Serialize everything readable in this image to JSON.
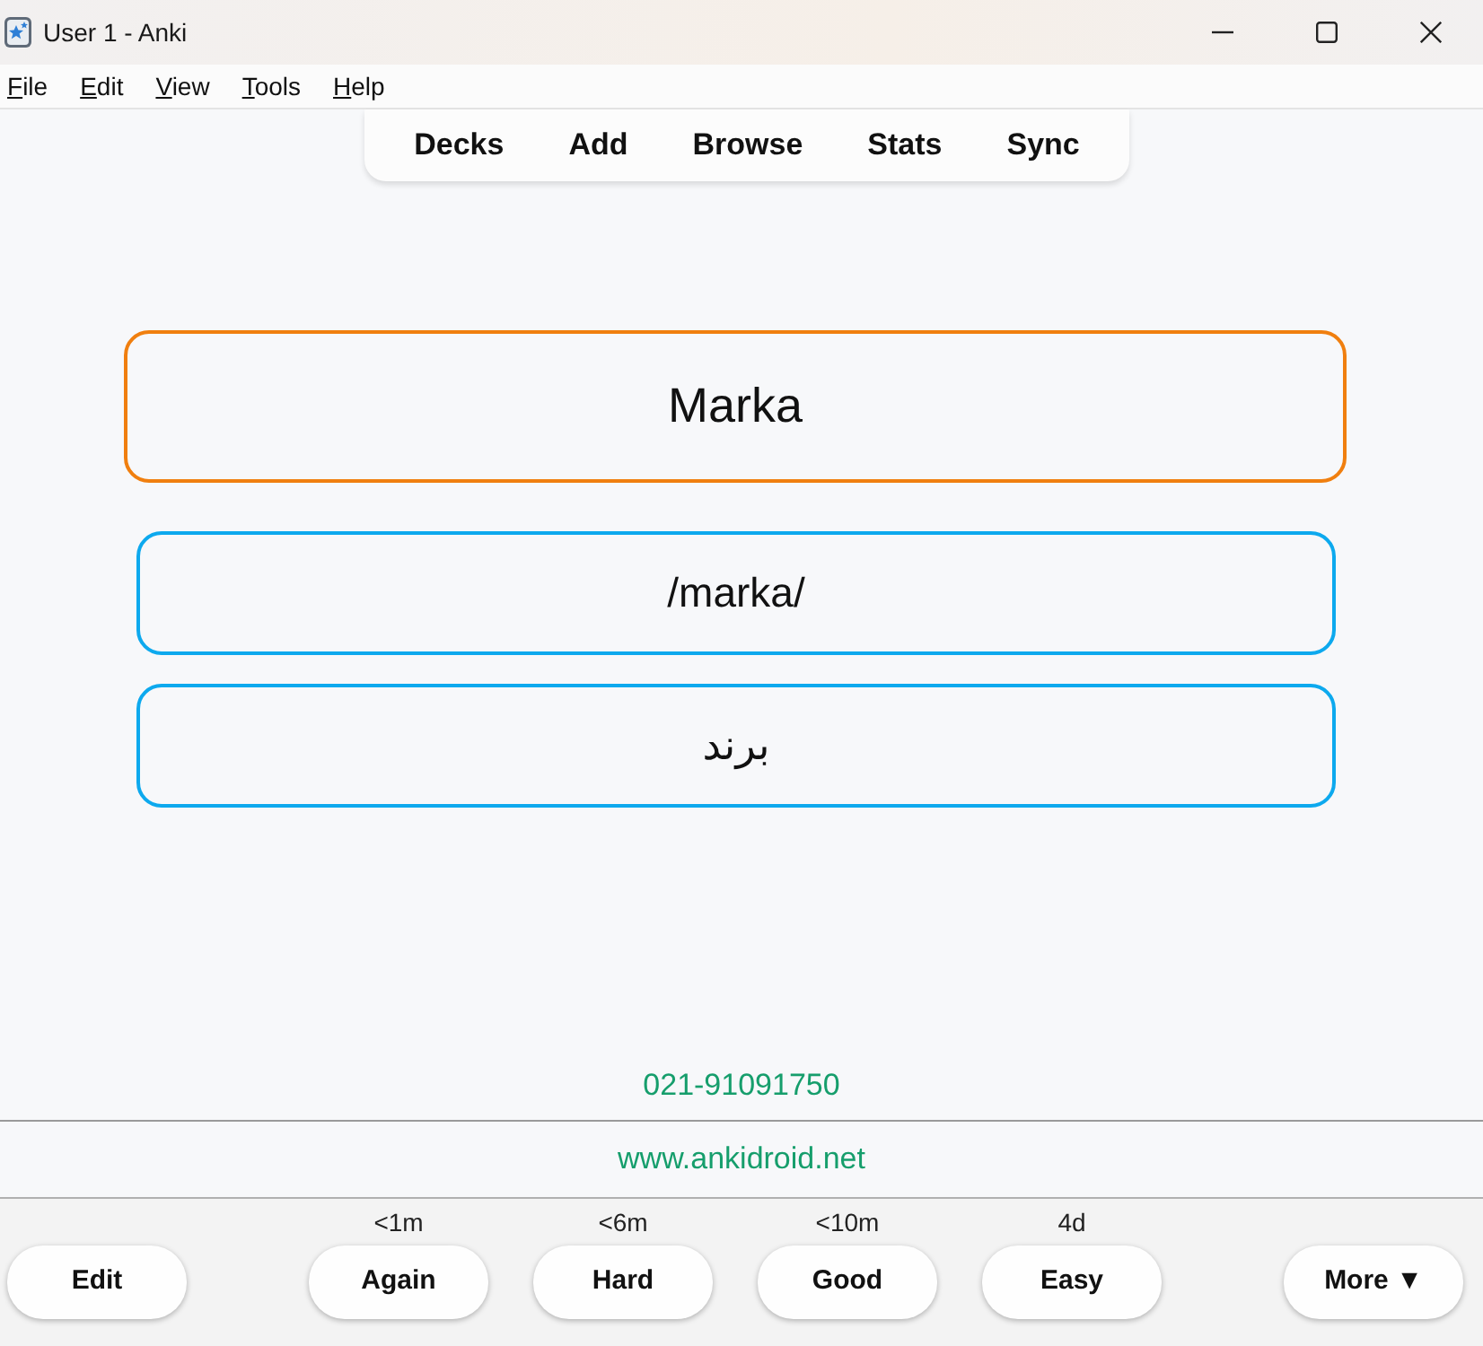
{
  "window": {
    "title": "User 1 - Anki"
  },
  "menu": [
    "File",
    "Edit",
    "View",
    "Tools",
    "Help"
  ],
  "toolbar": [
    "Decks",
    "Add",
    "Browse",
    "Stats",
    "Sync"
  ],
  "card": {
    "front": "Marka",
    "fields": [
      "/marka/",
      "برند"
    ]
  },
  "footer": {
    "phone": "021-91091750",
    "link": "www.ankidroid.net"
  },
  "answer_bar": {
    "edit": "Edit",
    "buttons": [
      {
        "label": "Again",
        "interval": "<1m"
      },
      {
        "label": "Hard",
        "interval": "<6m"
      },
      {
        "label": "Good",
        "interval": "<10m"
      },
      {
        "label": "Easy",
        "interval": "4d"
      }
    ],
    "more": "More ▼"
  }
}
